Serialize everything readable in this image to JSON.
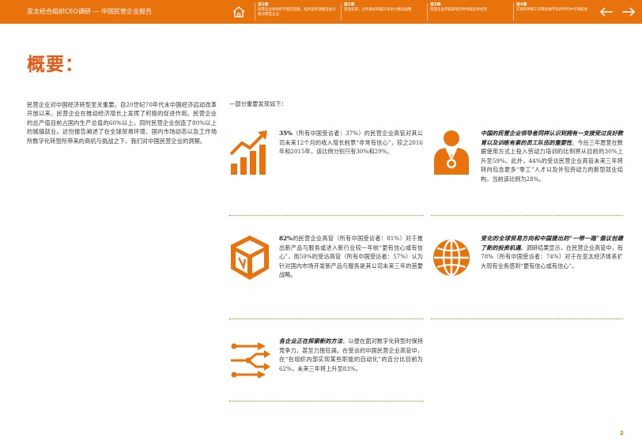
{
  "header": {
    "brand": "亚太经合组织CEO调研 — 中国民营企业报告",
    "chapters": [
      {
        "label": "第1章",
        "text": "民营企业领导的不稳定因素，担忧盈利放缓且加大重点转型企业"
      },
      {
        "label": "第2章",
        "text": "演变前景，业务增长和提升竞争力推动战略"
      },
      {
        "label": "第3章",
        "text": "民营企业开拓新经济并构建竞争优势"
      },
      {
        "label": "第4章",
        "text": "在新形势和工作模式数字化的时代中引领前进"
      }
    ]
  },
  "page": {
    "title": "概要：",
    "intro": "民营企业对中国经济转型至关重要。自20世纪70年代末中国经济启动改革开放以来，民营企业在推动经济增长上发挥了积极的促进作用。民营企业的总产值目前占国内生产总值的60%以上，同时民营企业创造了80%以上的城镇就业。这份报告阐述了在全球贸易环境、国内市场动态以及工作场所数字化转型所带来的商机与挑战之下，我们对中国民营企业的洞察。",
    "findings_intro": "一部分重要发现如下：",
    "page_number": "2"
  },
  "findings": {
    "growth": {
      "lead": "35%",
      "text": "（所有中国受访者：37%）的民营企业高管对其公司未来12个月的收入增长前景“非常有信心”，较之2016年和2015年，该比例分别只有30%和29%。"
    },
    "talent": {
      "highlight": "中国的民营企业领导者同样认识到拥有一支接受过良好教育以及训练有素的员工队伍的重要性",
      "text": "。今后三年愿意在数据使用方式上投入劳动力培训的比例将从目前的30%上升至59%。此外，44%的受访民营企业高管未来三年将转向包含更多“零工”人才以及外包劳动力的新型就业结构，当前该比例为28%。"
    },
    "products": {
      "lead": "82%",
      "text": "的民营企业高管（所有中国受访者：81%）对于推出新产品与服务或进入新行业较一年前“更有信心或有信心”，而59%的受访高管（所有中国受访者：57%）认为针对国内市场开发新产品与服务是其公司未来三年的首要战略。"
    },
    "trade": {
      "highlight": "变化的全球贸易方向和中国提出的“一带一路”倡议创建了新的投资机遇",
      "text": "。调研结果显示，在民营企业高管中，有78%（所有中国受访者：74%）对于在亚太经济体系扩大现有业务感到“更有信心或有信心”。"
    },
    "digital": {
      "highlight": "各企业正在探索新的方法",
      "text": "，以便在面对数字化转型时保持竞争力，甚至力挽狂澜。在受访的中国民营企业高管中，在“在组织内部实现某些职能的自动化”的百分比目前为62%，未来三年将上升至83%。"
    }
  },
  "colors": {
    "accent": "#e8720c",
    "title": "#e35a14",
    "text": "#3a3a3a"
  },
  "icons": [
    "home-icon",
    "growth-chart-icon",
    "medal-person-icon",
    "product-cube-icon",
    "globe-icon",
    "circuit-arrows-icon",
    "arrow-left-icon",
    "arrow-right-icon"
  ]
}
